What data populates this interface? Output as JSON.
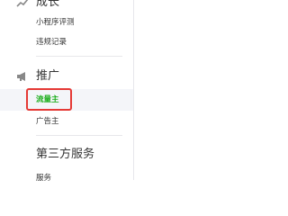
{
  "colors": {
    "accent": "#1aad19",
    "text": "#353535",
    "highlight": "#e53935",
    "active_bg": "#f4f5f9",
    "divider": "#e7e7eb"
  },
  "sidebar": {
    "groups": [
      {
        "title": "成长",
        "icon": "growth-icon",
        "items": [
          {
            "label": "小程序评测"
          },
          {
            "label": "违规记录"
          }
        ]
      },
      {
        "title": "推广",
        "icon": "megaphone-icon",
        "items": [
          {
            "label": "流量主",
            "active": true
          },
          {
            "label": "广告主"
          }
        ]
      },
      {
        "title": "第三方服务",
        "items": [
          {
            "label": "服务"
          }
        ]
      }
    ]
  }
}
